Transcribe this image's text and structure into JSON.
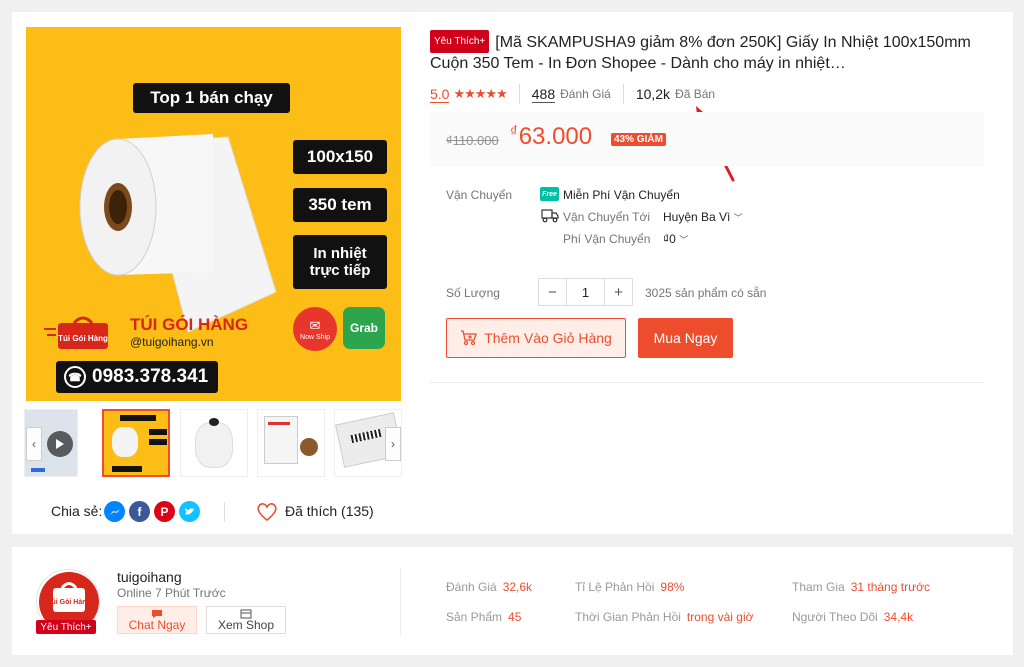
{
  "image": {
    "top_badge": "Top 1 bán chạy",
    "size": "100x150",
    "count": "350 tem",
    "method_line1": "In nhiệt",
    "method_line2": "trực tiếp",
    "brand_bag_text": "Túi Gói Hàng",
    "brand_name": "TÚI GÓI HÀNG",
    "brand_site": "@tuigoihang.vn",
    "nowship": "Now Ship",
    "grab": "Grab",
    "phone": "0983.378.341"
  },
  "share": {
    "label": "Chia sẻ:",
    "liked": "Đã thích (135)"
  },
  "product": {
    "badge": "Yêu Thích+",
    "title": "[Mã SKAMPUSHA9 giảm 8% đơn 250K] Giấy In Nhiệt 100x150mm Cuộn 350 Tem - In Đơn Shopee - Dành cho máy in nhiệt…",
    "rating": "5.0",
    "stars": "★★★★★",
    "reviews_count": "488",
    "reviews_label": "Đánh Giá",
    "sold_count": "10,2k",
    "sold_label": "Đã Bán",
    "old_price": "₫110.000",
    "currency": "₫",
    "price": "63.000",
    "discount": "43% GIẢM"
  },
  "shipping": {
    "label": "Vận Chuyển",
    "free_icon": "Free",
    "free": "Miễn Phí Vận Chuyển",
    "to_label": "Vận Chuyển Tới",
    "to_value": "Huyện Ba Vì",
    "fee_label": "Phí Vận Chuyển",
    "fee_value": "₫0"
  },
  "quantity": {
    "label": "Số Lượng",
    "minus": "−",
    "value": "1",
    "plus": "+",
    "stock": "3025 sản phẩm có sẵn"
  },
  "actions": {
    "add_to_cart": "Thêm Vào Giỏ Hàng",
    "buy_now": "Mua Ngay"
  },
  "shop": {
    "name": "tuigoihang",
    "online": "Online 7 Phút Trước",
    "badge": "Yêu Thích+",
    "logo_text": "Túi Gói Hàng",
    "chat": "Chat Ngay",
    "view": "Xem Shop",
    "stats": {
      "ratings_label": "Đánh Giá",
      "ratings": "32,6k",
      "response_label": "Tỉ Lệ Phản Hồi",
      "response": "98%",
      "joined_label": "Tham Gia",
      "joined": "31 tháng trước",
      "products_label": "Sản Phẩm",
      "products": "45",
      "response_time_label": "Thời Gian Phản Hồi",
      "response_time": "trong vài giờ",
      "followers_label": "Người Theo Dõi",
      "followers": "34,4k"
    }
  },
  "colors": {
    "accent": "#ee4d2d",
    "image_bg": "#fcbd16",
    "annotation": "#e02020"
  }
}
